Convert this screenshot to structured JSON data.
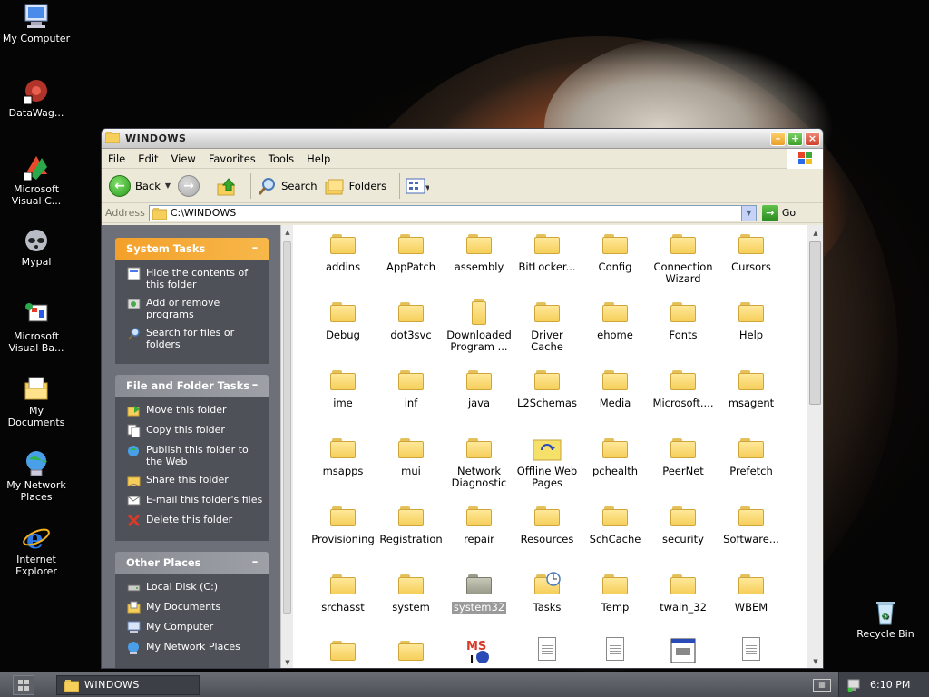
{
  "desktop": {
    "icons": [
      {
        "label": "My Computer",
        "icon": "my-computer-icon"
      },
      {
        "label": "DataWag...",
        "icon": "datawag-icon"
      },
      {
        "label": "Microsoft Visual C...",
        "icon": "visual-c-icon"
      },
      {
        "label": "Mypal",
        "icon": "mypal-icon"
      },
      {
        "label": "Microsoft Visual Ba...",
        "icon": "visual-basic-icon"
      },
      {
        "label": "My Documents",
        "icon": "my-documents-icon"
      },
      {
        "label": "My Network Places",
        "icon": "network-places-icon"
      },
      {
        "label": "Internet Explorer",
        "icon": "internet-explorer-icon"
      },
      {
        "label": "Recycle Bin",
        "icon": "recycle-bin-icon"
      }
    ]
  },
  "window": {
    "title": "WINDOWS",
    "menu": [
      "File",
      "Edit",
      "View",
      "Favorites",
      "Tools",
      "Help"
    ],
    "toolbar": {
      "back": "Back",
      "search": "Search",
      "folders": "Folders"
    },
    "address": {
      "label": "Address",
      "value": "C:\\WINDOWS",
      "go": "Go"
    },
    "system_tasks": {
      "title": "System Tasks",
      "items": [
        "Hide the contents of this folder",
        "Add or remove programs",
        "Search for files or folders"
      ]
    },
    "file_folder_tasks": {
      "title": "File and Folder Tasks",
      "items": [
        "Move this folder",
        "Copy this folder",
        "Publish this folder to the Web",
        "Share this folder",
        "E-mail this folder's files",
        "Delete this folder"
      ]
    },
    "other_places": {
      "title": "Other Places",
      "items": [
        "Local Disk (C:)",
        "My Documents",
        "My Computer",
        "My Network Places"
      ]
    },
    "files": [
      "addins",
      "AppPatch",
      "assembly",
      "BitLocker...",
      "Config",
      "Connection Wizard",
      "Cursors",
      "Debug",
      "dot3svc",
      "Downloaded Program ...",
      "Driver Cache",
      "ehome",
      "Fonts",
      "Help",
      "ime",
      "inf",
      "java",
      "L2Schemas",
      "Media",
      "Microsoft....",
      "msagent",
      "msapps",
      "mui",
      "Network Diagnostic",
      "Offline Web Pages",
      "pchealth",
      "PeerNet",
      "Prefetch",
      "Provisioning",
      "Registration",
      "repair",
      "Resources",
      "SchCache",
      "security",
      "Software...",
      "srchasst",
      "system",
      "system32",
      "Tasks",
      "Temp",
      "twain_32",
      "WBEM"
    ],
    "selected_file": "system32"
  },
  "taskbar": {
    "task": "WINDOWS",
    "clock": "6:10 PM"
  }
}
